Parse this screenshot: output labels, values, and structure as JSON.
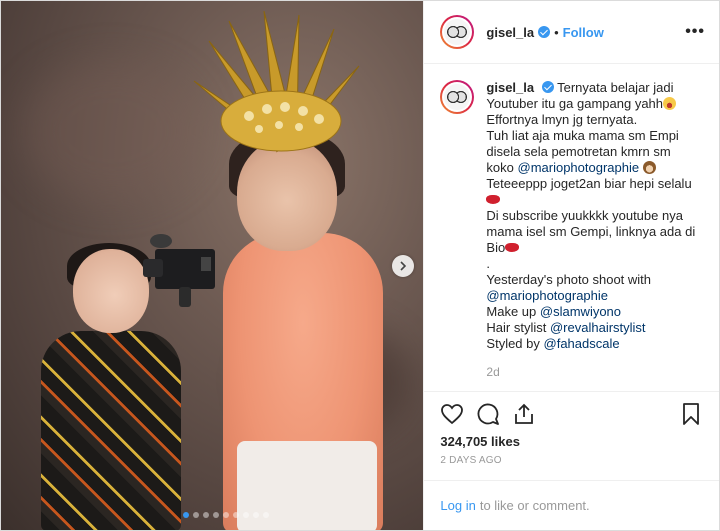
{
  "post": {
    "username": "gisel_la",
    "follow_label": "Follow",
    "more_label": "•••",
    "separator": "•"
  },
  "caption": {
    "username": "gisel_la",
    "lines": [
      "Ternyata belajar jadi",
      "Youtuber itu ga gampang yahh",
      "Effortnya lmyn jg ternyata.",
      "Tuh liat aja muka mama sm Empi",
      "disela sela pemotretan kmrn sm",
      "koko",
      "Teteeeppp joget2an biar hepi selalu",
      "Di subscribe yuukkkk youtube nya",
      "mama isel sm Gempi, linknya ada di",
      "Bio",
      ".",
      "Yesterday's photo shoot with",
      "Make up",
      "Hair stylist",
      "Styled by"
    ],
    "mentions": {
      "mario1": "@mariophotographie",
      "mario2": "@mariophotographie",
      "makeup": "@slamwiyono",
      "hair": "@revalhairstylist",
      "styled": "@fahadscale"
    },
    "age": "2d"
  },
  "actions": {
    "likes": "324,705 likes",
    "time_ago": "2 DAYS AGO",
    "icons": [
      "heart-icon",
      "comment-icon",
      "share-icon",
      "bookmark-icon"
    ]
  },
  "login": {
    "link": "Log in",
    "text": "to like or comment."
  },
  "carousel": {
    "count": 9,
    "active_index": 0
  },
  "colors": {
    "accent": "#3897f0",
    "mention": "#003569",
    "muted": "#999999"
  }
}
